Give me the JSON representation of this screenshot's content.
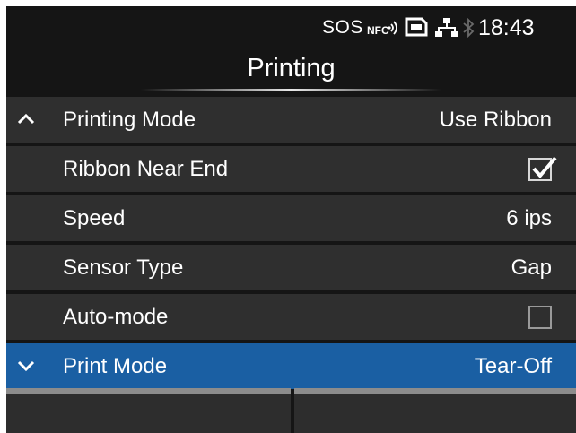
{
  "status_bar": {
    "sos": "SOS",
    "icons": [
      "nfc-icon",
      "sd-card-icon",
      "lan-icon",
      "bluetooth-icon"
    ],
    "time": "18:43"
  },
  "title": "Printing",
  "rows": [
    {
      "label": "Printing Mode",
      "value": "Use Ribbon",
      "scroll_icon": "chevron-up-icon"
    },
    {
      "label": "Ribbon Near End",
      "checkbox": true
    },
    {
      "label": "Speed",
      "value": "6 ips"
    },
    {
      "label": "Sensor Type",
      "value": "Gap"
    },
    {
      "label": "Auto-mode",
      "checkbox": false
    },
    {
      "label": "Print Mode",
      "value": "Tear-Off",
      "scroll_icon": "chevron-down-icon",
      "selected": true
    }
  ],
  "softkeys": {
    "left": "",
    "right": ""
  },
  "colors": {
    "background": "#151515",
    "row": "#2f2f2f",
    "selected": "#1a5fa3",
    "text": "#ffffff"
  }
}
